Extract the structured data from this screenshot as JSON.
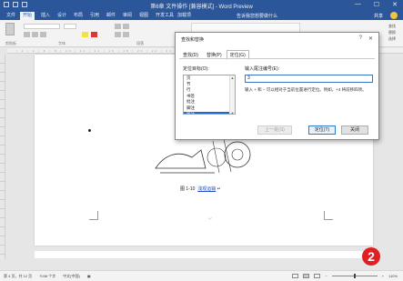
{
  "window": {
    "title": "第6章 文件操作 [兼容模式] - Word Preview",
    "controls": [
      "—",
      "☐",
      "✕"
    ]
  },
  "ribbon_tabs": [
    "文件",
    "开始",
    "插入",
    "设计",
    "布局",
    "引用",
    "邮件",
    "审阅",
    "视图",
    "开发工具",
    "加载项"
  ],
  "active_tab_index": 1,
  "search_placeholder": "告诉我您想要做什么",
  "share_label": "共享",
  "ribbon_groups": [
    "剪贴板",
    "字体",
    "段落",
    "样式"
  ],
  "find_items": [
    "查找",
    "替换",
    "选择"
  ],
  "ruler_marks": "| 2 | 4 | 6 | 8 | 10 | 12 | 14 | 16 | 18 | 20 | 22 | 24 | 26 | 28 | 30 | 32 | 34 | 36 | 38 | 40 | 42 | 44 | 46 |",
  "document": {
    "caption_label": "图 1-10",
    "caption_link": "浅观运输",
    "caption_suffix": "↵",
    "para_mark": "↵"
  },
  "dialog": {
    "title": "查找和替换",
    "help": "?",
    "close": "✕",
    "tabs": [
      "查找(D)",
      "替换(P)",
      "定位(G)"
    ],
    "active_tab_index": 2,
    "target_label": "定位目标(O):",
    "targets": [
      "页",
      "节",
      "行",
      "书签",
      "批注",
      "脚注",
      "尾注"
    ],
    "selected_target_index": 6,
    "input_label": "输入尾注编号(E):",
    "input_value": "3",
    "hint": "输入 + 和 − 可以相对于当前位置进行定位。例如，+4 将前移四项。",
    "buttons": {
      "goto": "上一处(S)",
      "next": "定位(T)",
      "close": "关闭"
    }
  },
  "status": {
    "page": "第 4 页，共 12 页",
    "words": "7048 个字",
    "lang": "中文(中国)",
    "zoom": "110%"
  },
  "callout_number": "2",
  "colors": {
    "accent": "#2b579a",
    "selection": "#1e6cc8",
    "badge": "#e02020",
    "link": "#1f4fc9"
  }
}
